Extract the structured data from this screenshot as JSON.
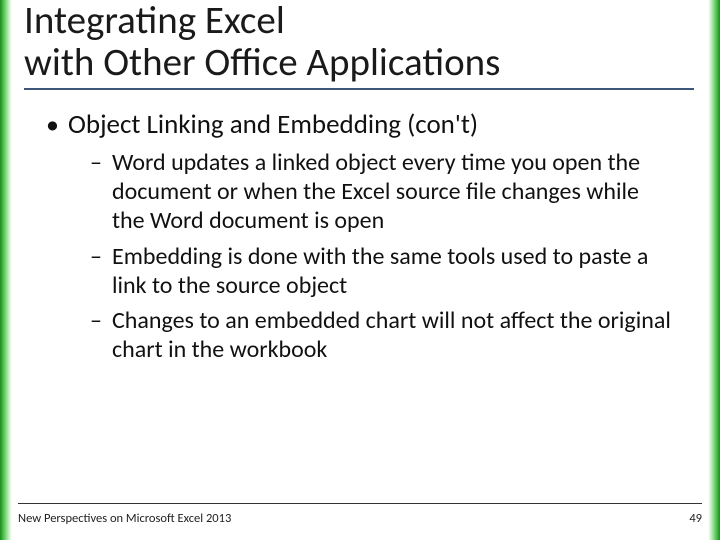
{
  "title": {
    "line1": "Integrating Excel",
    "line2": "with Other Office Applications"
  },
  "body": {
    "l1": "Object Linking and Embedding (con't)",
    "l2": [
      "Word updates a linked object every time you open the document or when the Excel source file changes while the Word document is open",
      "Embedding is done with the same tools used to paste a link to the source object",
      "Changes to an embedded chart will not affect the original chart in the workbook"
    ]
  },
  "footer": {
    "left": "New Perspectives on Microsoft Excel 2013",
    "page": "49"
  }
}
